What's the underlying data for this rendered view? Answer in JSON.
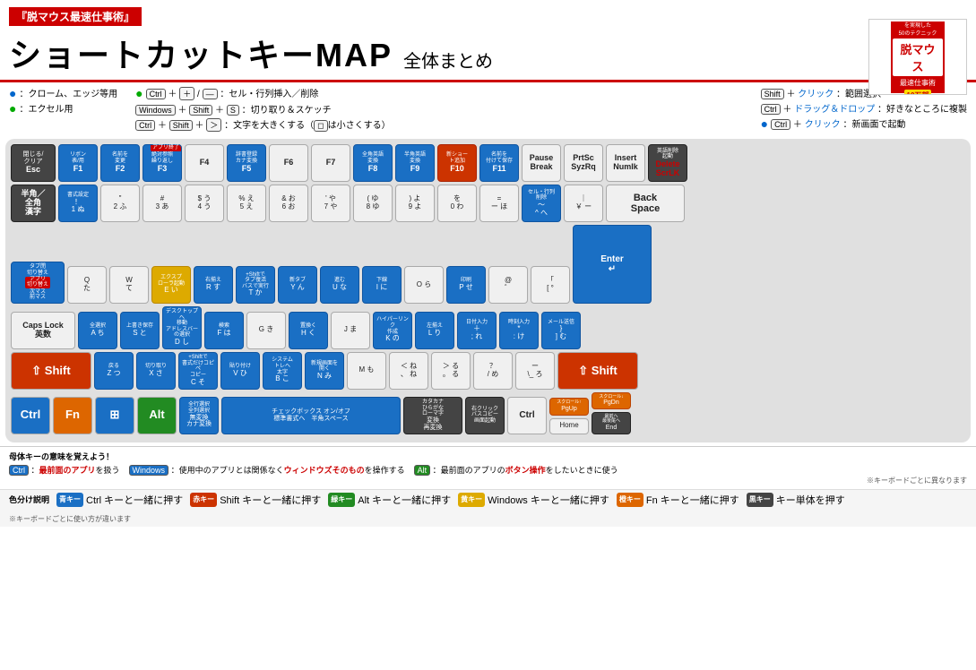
{
  "header": {
    "book_title": "『脱マウス最速仕事術』",
    "main_title": "ショートカットキーMAP",
    "sub_title": "全体まとめ"
  },
  "legend": {
    "dot1": "：クローム、エッジ等用",
    "dot2": "：エクセル用",
    "item1": "Ctrl ＋ ＋ / — ：セル・行列挿入／削除",
    "item2": "Windows ＋ Shift ＋ S ：切り取り＆スケッチ",
    "item3": "Ctrl ＋ Shift ＋ ＞ ：文字を大きくする（◻は小さくする）",
    "item4": "Shift ＋ クリック ：範囲選択",
    "item5": "Ctrl ＋ ドラッグ＆ドロップ ：好きなところに複製",
    "item6": "Ctrl ＋ クリック ：新画面で起動"
  },
  "footer_note": "※キーボードごとに異なります",
  "key_legend": {
    "title": "母体キーの意味を覚えよう！",
    "ctrl_desc": "Ctrl ：最前面のアプリを扱う",
    "win_desc": "Windows ：使用中のアプリとは関係なくウィンドウズそのものを操作する",
    "alt_desc": "Alt ：最前面のアプリのボタン操作をしたいときに使う"
  },
  "color_legend": {
    "title": "色分け説明",
    "blue": "青キー",
    "blue_desc": "Ctrl キーと一緒に押す",
    "red": "赤キー",
    "red_desc": "Shift キーと一緒に押す",
    "green": "緑キー",
    "green_desc": "Alt キーと一緒に押す",
    "yellow": "黄キー",
    "yellow_desc": "Windows キーと一緒に押す",
    "orange": "橙キー",
    "orange_desc": "Fn キーと一緒に押す",
    "dark": "黒キー",
    "dark_desc": "キー単体を押す",
    "note": "※キーボードごとに使い方が違います"
  }
}
